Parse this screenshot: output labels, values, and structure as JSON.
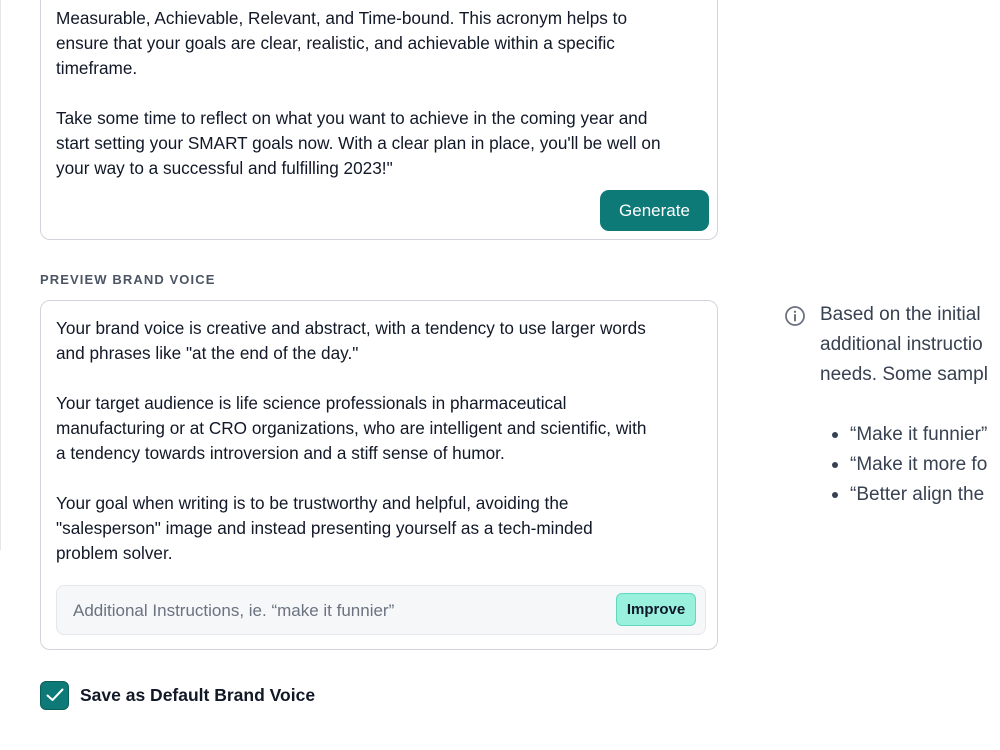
{
  "generated": {
    "lines": [
      "Measurable, Achievable, Relevant, and Time-bound. This acronym helps to",
      "ensure that your goals are clear, realistic, and achievable within a specific",
      "timeframe."
    ],
    "closing_lines": [
      "Take some time to reflect on what you want to achieve in the coming year and",
      "start setting your SMART goals now. With a clear plan in place, you'll be well on",
      "your way to a successful and fulfilling 2023!\""
    ],
    "generate_label": "Generate"
  },
  "preview": {
    "section_label": "PREVIEW BRAND VOICE",
    "para1": [
      "Your brand voice is creative and abstract, with a tendency to use larger words",
      "and phrases like \"at the end of the day.\""
    ],
    "para2": [
      "Your target audience is life science professionals in pharmaceutical",
      "manufacturing or at CRO organizations, who are intelligent and scientific, with",
      "a tendency towards introversion and a stiff sense of humor."
    ],
    "para3": [
      "Your goal when writing is to be trustworthy and helpful, avoiding the",
      "\"salesperson\" image and instead presenting yourself as a tech-minded",
      "problem solver."
    ],
    "instructions": {
      "placeholder": "Additional Instructions, ie. “make it funnier”",
      "value": ""
    },
    "improve_label": "Improve"
  },
  "default_voice": {
    "checked": true,
    "label": "Save as Default Brand Voice"
  },
  "info": {
    "icon": "info-icon",
    "lines": [
      "Based on the initial",
      "additional instructio",
      "needs. Some sampl"
    ],
    "examples": [
      "“Make it funnier”",
      "“Make it more fo",
      "“Better align the"
    ]
  },
  "colors": {
    "accent": "#0d7a78",
    "improve_bg": "#99f0dc"
  }
}
